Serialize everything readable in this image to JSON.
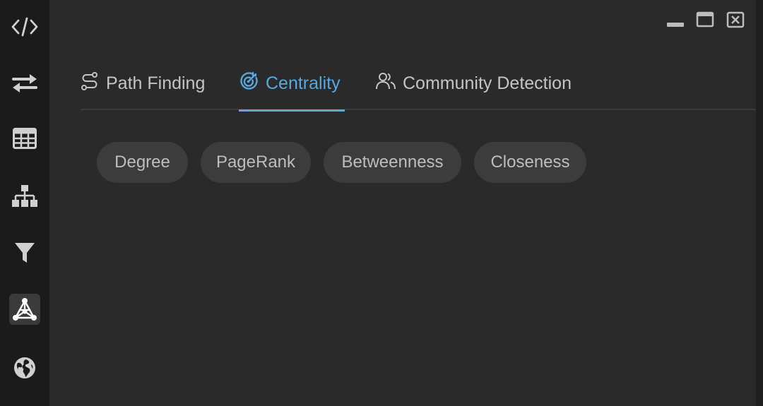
{
  "sidebar": {
    "items": [
      {
        "icon": "code-icon"
      },
      {
        "icon": "swap-arrows-icon"
      },
      {
        "icon": "table-icon"
      },
      {
        "icon": "hierarchy-icon"
      },
      {
        "icon": "filter-icon"
      },
      {
        "icon": "graph-network-icon",
        "active": true
      },
      {
        "icon": "globe-icon"
      }
    ]
  },
  "window_controls": {
    "minimize": "minimize-icon",
    "maximize": "maximize-icon",
    "close": "close-icon"
  },
  "tabs": [
    {
      "label": "Path Finding",
      "icon": "route-icon"
    },
    {
      "label": "Centrality",
      "icon": "target-icon",
      "active": true
    },
    {
      "label": "Community Detection",
      "icon": "users-icon"
    }
  ],
  "algorithms": [
    {
      "label": "Degree"
    },
    {
      "label": "PageRank"
    },
    {
      "label": "Betweenness"
    },
    {
      "label": "Closeness"
    }
  ],
  "colors": {
    "accent": "#58a8e0",
    "background": "#2a2a2a",
    "sidebar": "#1b1b1b",
    "chip": "#3c3c3c"
  }
}
